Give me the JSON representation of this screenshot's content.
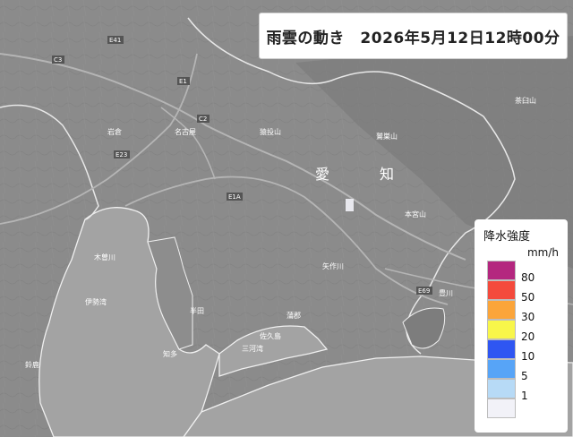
{
  "title": "雨雲の動き　2026年5月12日12時00分",
  "legend": {
    "title": "降水強度",
    "unit": "mm/h",
    "levels": [
      {
        "value": "80",
        "color": "#b4277f"
      },
      {
        "value": "50",
        "color": "#f44a3c"
      },
      {
        "value": "30",
        "color": "#fba53a"
      },
      {
        "value": "20",
        "color": "#f8f64a"
      },
      {
        "value": "10",
        "color": "#2f56f2"
      },
      {
        "value": "5",
        "color": "#57a4f7"
      },
      {
        "value": "1",
        "color": "#b7daf6"
      },
      {
        "value": "",
        "color": "#f2f2f8"
      }
    ]
  },
  "map": {
    "region_chars": [
      "愛",
      "知"
    ],
    "places": [
      "岩倉",
      "名古屋",
      "猿投山",
      "茶臼山",
      "鷲巣山",
      "本宮山",
      "蒲郡",
      "半田",
      "伊勢湾",
      "三河湾",
      "佐久島",
      "知多",
      "木曽川",
      "鈴鹿",
      "矢作川",
      "豊川"
    ],
    "roads": [
      "C3",
      "E1",
      "E1A",
      "E23",
      "C2",
      "E69",
      "E41"
    ]
  }
}
